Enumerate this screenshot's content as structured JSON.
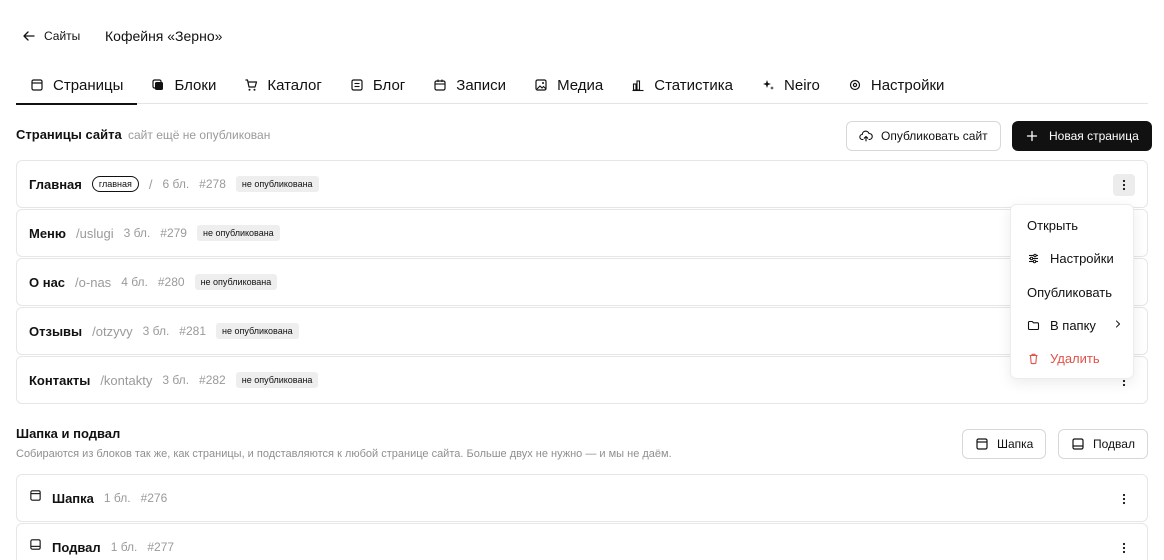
{
  "header": {
    "back_label": "Сайты",
    "site_name": "Кофейня «Зерно»"
  },
  "tabs": [
    {
      "label": "Страницы",
      "icon": "page-icon",
      "active": true
    },
    {
      "label": "Блоки",
      "icon": "blocks-icon",
      "active": false
    },
    {
      "label": "Каталог",
      "icon": "cart-icon",
      "active": false
    },
    {
      "label": "Блог",
      "icon": "article-icon",
      "active": false
    },
    {
      "label": "Записи",
      "icon": "calendar-icon",
      "active": false
    },
    {
      "label": "Медиа",
      "icon": "image-icon",
      "active": false
    },
    {
      "label": "Статистика",
      "icon": "chart-icon",
      "active": false
    },
    {
      "label": "Neiro",
      "icon": "sparkle-icon",
      "active": false
    },
    {
      "label": "Настройки",
      "icon": "gear-icon",
      "active": false
    }
  ],
  "pages_section": {
    "title": "Страницы сайта",
    "subtitle": "сайт ещё не опубликован",
    "publish_label": "Опубликовать сайт",
    "new_page_label": "Новая страница"
  },
  "pages": [
    {
      "name": "Главная",
      "pill": "главная",
      "slug": "/",
      "blocks": "6 бл.",
      "id": "#278",
      "status": "не опубликована"
    },
    {
      "name": "Меню",
      "slug": "/uslugi",
      "blocks": "3 бл.",
      "id": "#279",
      "status": "не опубликована"
    },
    {
      "name": "О нас",
      "slug": "/o-nas",
      "blocks": "4 бл.",
      "id": "#280",
      "status": "не опубликована"
    },
    {
      "name": "Отзывы",
      "slug": "/otzyvy",
      "blocks": "3 бл.",
      "id": "#281",
      "status": "не опубликована"
    },
    {
      "name": "Контакты",
      "slug": "/kontakty",
      "blocks": "3 бл.",
      "id": "#282",
      "status": "не опубликована"
    }
  ],
  "context_menu": {
    "open": "Открыть",
    "settings": "Настройки",
    "publish": "Опубликовать",
    "move": "В папку",
    "delete": "Удалить"
  },
  "header_footer": {
    "title": "Шапка и подвал",
    "subtitle": "Собираются из блоков так же, как страницы, и подставляются к любой странице сайта. Больше двух не нужно — и мы не даём.",
    "header_btn": "Шапка",
    "footer_btn": "Подвал",
    "items": [
      {
        "name": "Шапка",
        "blocks": "1 бл.",
        "id": "#276"
      },
      {
        "name": "Подвал",
        "blocks": "1 бл.",
        "id": "#277"
      }
    ]
  },
  "colors": {
    "accent": "#111111",
    "danger": "#e0524a",
    "muted": "#9a9a9a"
  }
}
